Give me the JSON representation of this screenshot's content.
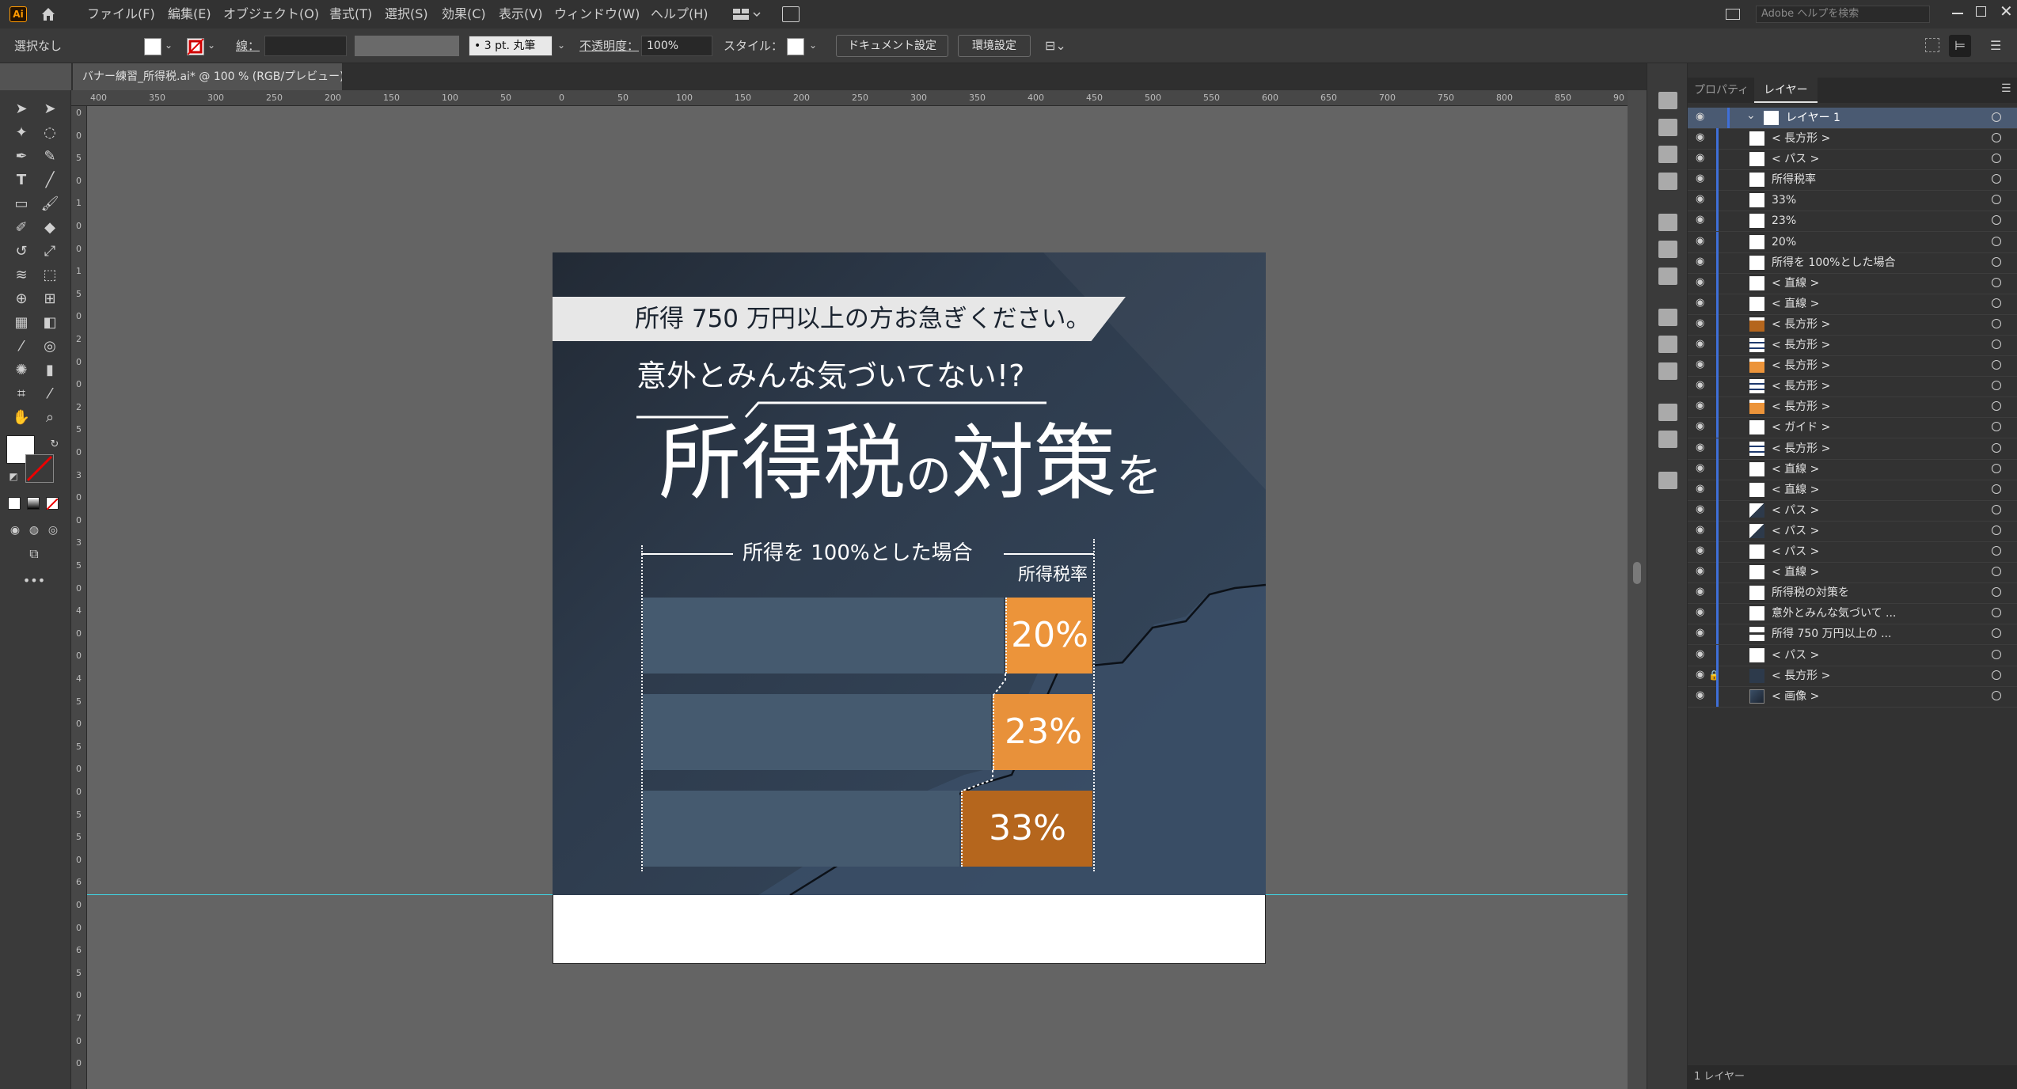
{
  "menu": {
    "app_logo": "Ai",
    "items": [
      "ファイル(F)",
      "編集(E)",
      "オブジェクト(O)",
      "書式(T)",
      "選択(S)",
      "効果(C)",
      "表示(V)",
      "ウィンドウ(W)",
      "ヘルプ(H)"
    ],
    "help_search_placeholder": "Adobe ヘルプを検索"
  },
  "control": {
    "selection": "選択なし",
    "stroke_label": "線：",
    "brush": "3 pt. 丸筆",
    "opacity_label": "不透明度：",
    "opacity_value": "100%",
    "style_label": "スタイル：",
    "doc_settings": "ドキュメント設定",
    "preferences": "環境設定"
  },
  "document": {
    "tab_title": "バナー練習_所得税.ai* @ 100 % (RGB/プレビュー)"
  },
  "rulers": {
    "h_labels": [
      "400",
      "350",
      "300",
      "250",
      "200",
      "150",
      "100",
      "50",
      "0",
      "50",
      "100",
      "150",
      "200",
      "250",
      "300",
      "350",
      "400",
      "450",
      "500",
      "550",
      "600",
      "650",
      "700",
      "750",
      "800",
      "850",
      "90"
    ],
    "v_labels": [
      "0",
      "0",
      "5",
      "0",
      "1",
      "0",
      "0",
      "1",
      "5",
      "0",
      "2",
      "0",
      "0",
      "2",
      "5",
      "0",
      "3",
      "0",
      "0",
      "3",
      "5",
      "0",
      "4",
      "0",
      "0",
      "4",
      "5",
      "0",
      "5",
      "0",
      "0",
      "5",
      "5",
      "0",
      "6",
      "0",
      "0",
      "6",
      "5",
      "0",
      "7",
      "0",
      "0"
    ]
  },
  "artwork": {
    "header_strip": "所得 750 万円以上の方お急ぎください。",
    "subheadline": "意外とみんな気づいてない!?",
    "headline_main1": "所得税",
    "headline_no": "の",
    "headline_main2": "対策",
    "headline_wo": "を",
    "chart_caption": "所得を 100%とした場合",
    "rate_header": "所得税率",
    "rates": [
      "20%",
      "23%",
      "33%"
    ],
    "colors": {
      "orange1": "#ec943a",
      "orange2": "#e8913a",
      "orange3": "#b5661d",
      "bar": "#455a6f",
      "bg_dark": "#222a35"
    }
  },
  "panel": {
    "tab_properties": "プロパティ",
    "tab_layers": "レイヤー",
    "layer_name": "レイヤー 1",
    "footer": "1 レイヤー",
    "items": [
      {
        "name": "< 長方形 >",
        "thumb": "white"
      },
      {
        "name": "< パス >",
        "thumb": "white"
      },
      {
        "name": "所得税率",
        "thumb": "white"
      },
      {
        "name": "33%",
        "thumb": "white"
      },
      {
        "name": "23%",
        "thumb": "white"
      },
      {
        "name": "20%",
        "thumb": "white"
      },
      {
        "name": "所得を 100%とした場合",
        "thumb": "white"
      },
      {
        "name": "< 直線 >",
        "thumb": "white"
      },
      {
        "name": "< 直線 >",
        "thumb": "white"
      },
      {
        "name": "< 長方形 >",
        "thumb": "brown"
      },
      {
        "name": "< 長方形 >",
        "thumb": "lines"
      },
      {
        "name": "< 長方形 >",
        "thumb": "orange"
      },
      {
        "name": "< 長方形 >",
        "thumb": "lines"
      },
      {
        "name": "< 長方形 >",
        "thumb": "orange"
      },
      {
        "name": "< ガイド >",
        "thumb": "white"
      },
      {
        "name": "< 長方形 >",
        "thumb": "lines"
      },
      {
        "name": "< 直線 >",
        "thumb": "white"
      },
      {
        "name": "< 直線 >",
        "thumb": "white"
      },
      {
        "name": "< パス >",
        "thumb": "diag"
      },
      {
        "name": "< パス >",
        "thumb": "diag"
      },
      {
        "name": "< パス >",
        "thumb": "white"
      },
      {
        "name": "< 直線 >",
        "thumb": "white"
      },
      {
        "name": "所得税の対策を",
        "thumb": "white"
      },
      {
        "name": "意外とみんな気づいて ...",
        "thumb": "white"
      },
      {
        "name": "所得 750 万円以上の ...",
        "thumb": "strip"
      },
      {
        "name": "< パス >",
        "thumb": "white"
      },
      {
        "name": "< 長方形 >",
        "thumb": "navy"
      },
      {
        "name": "< 画像 >",
        "thumb": "image"
      }
    ]
  },
  "icons": [
    "home-icon",
    "arrange-icon",
    "share-icon",
    "minimize-icon",
    "maximize-icon",
    "close-icon",
    "eye-icon",
    "lock-icon",
    "chevron-down-icon"
  ]
}
